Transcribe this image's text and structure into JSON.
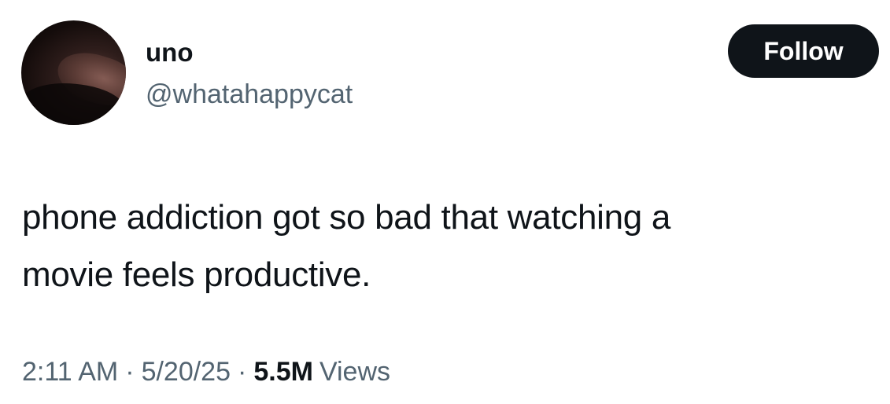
{
  "author": {
    "display_name": "uno",
    "handle": "@whatahappycat"
  },
  "follow_button": {
    "label": "Follow"
  },
  "tweet": {
    "text_line_1": "phone addiction got so bad that watching a",
    "text_line_2": "movie feels productive."
  },
  "meta": {
    "time": "2:11 AM",
    "date": "5/20/25",
    "separator": "·",
    "views_count": "5.5M",
    "views_label": "Views"
  },
  "colors": {
    "primary_text": "#0f1419",
    "secondary_text": "#536471",
    "button_bg": "#0f1419",
    "button_text": "#ffffff",
    "background": "#ffffff"
  }
}
